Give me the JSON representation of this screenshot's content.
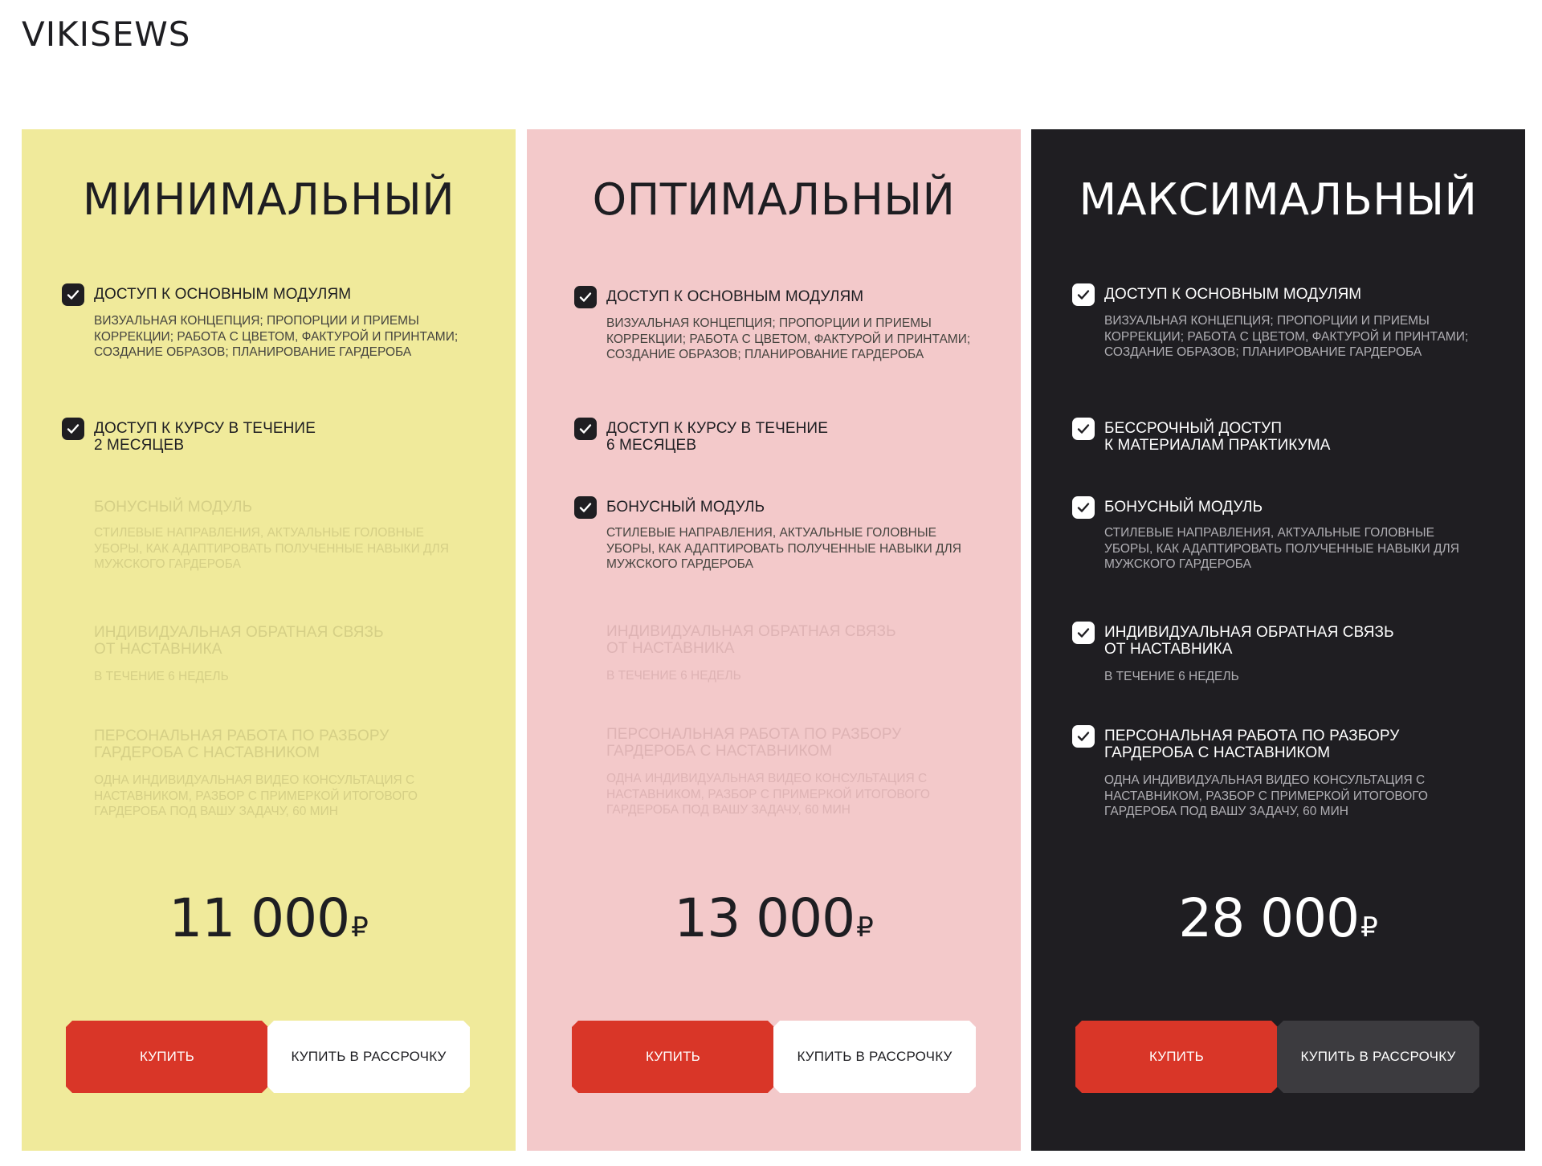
{
  "logo": "VIKISEWS",
  "plans": [
    {
      "title": "МИНИМАЛЬНЫЙ",
      "features": [
        {
          "included": true,
          "head": "ДОСТУП К ОСНОВНЫМ МОДУЛЯМ",
          "desc": "ВИЗУАЛЬНАЯ КОНЦЕПЦИЯ; ПРОПОРЦИИ И ПРИЕМЫ КОРРЕКЦИИ; РАБОТА С ЦВЕТОМ, ФАКТУРОЙ И ПРИНТАМИ; СОЗДАНИЕ ОБРАЗОВ; ПЛАНИРОВАНИЕ ГАРДЕРОБА"
        },
        {
          "included": true,
          "head": "ДОСТУП К КУРСУ В ТЕЧЕНИЕ\n2 МЕСЯЦЕВ",
          "desc": ""
        },
        {
          "included": false,
          "head": "БОНУСНЫЙ МОДУЛЬ",
          "desc": "СТИЛЕВЫЕ НАПРАВЛЕНИЯ, АКТУАЛЬНЫЕ ГОЛОВНЫЕ УБОРЫ, КАК АДАПТИРОВАТЬ ПОЛУЧЕННЫЕ НАВЫКИ ДЛЯ МУЖСКОГО ГАРДЕРОБА"
        },
        {
          "included": false,
          "head": "ИНДИВИДУАЛЬНАЯ ОБРАТНАЯ СВЯЗЬ\nОТ НАСТАВНИКА",
          "desc": "В ТЕЧЕНИЕ 6 НЕДЕЛЬ"
        },
        {
          "included": false,
          "head": "ПЕРСОНАЛЬНАЯ РАБОТА ПО РАЗБОРУ\nГАРДЕРОБА С НАСТАВНИКОМ",
          "desc": "ОДНА ИНДИВИДУАЛЬНАЯ ВИДЕО КОНСУЛЬТАЦИЯ С НАСТАВНИКОМ, РАЗБОР С ПРИМЕРКОЙ ИТОГОВОГО ГАРДЕРОБА ПОД ВАШУ ЗАДАЧУ, 60 МИН"
        }
      ],
      "price": "11 000",
      "currency": "₽",
      "buy_label": "КУПИТЬ",
      "installment_label": "КУПИТЬ В РАССРОЧКУ"
    },
    {
      "title": "ОПТИМАЛЬНЫЙ",
      "features": [
        {
          "included": true,
          "head": "ДОСТУП К ОСНОВНЫМ МОДУЛЯМ",
          "desc": "ВИЗУАЛЬНАЯ КОНЦЕПЦИЯ; ПРОПОРЦИИ И ПРИЕМЫ КОРРЕКЦИИ; РАБОТА С ЦВЕТОМ, ФАКТУРОЙ И ПРИНТАМИ; СОЗДАНИЕ ОБРАЗОВ; ПЛАНИРОВАНИЕ ГАРДЕРОБА"
        },
        {
          "included": true,
          "head": "ДОСТУП К КУРСУ В ТЕЧЕНИЕ\n6 МЕСЯЦЕВ",
          "desc": ""
        },
        {
          "included": true,
          "head": "БОНУСНЫЙ МОДУЛЬ",
          "desc": "СТИЛЕВЫЕ НАПРАВЛЕНИЯ, АКТУАЛЬНЫЕ ГОЛОВНЫЕ УБОРЫ, КАК АДАПТИРОВАТЬ ПОЛУЧЕННЫЕ НАВЫКИ ДЛЯ МУЖСКОГО ГАРДЕРОБА"
        },
        {
          "included": false,
          "head": "ИНДИВИДУАЛЬНАЯ ОБРАТНАЯ СВЯЗЬ\nОТ НАСТАВНИКА",
          "desc": "В ТЕЧЕНИЕ 6 НЕДЕЛЬ"
        },
        {
          "included": false,
          "head": "ПЕРСОНАЛЬНАЯ РАБОТА ПО РАЗБОРУ\nГАРДЕРОБА С НАСТАВНИКОМ",
          "desc": "ОДНА ИНДИВИДУАЛЬНАЯ ВИДЕО КОНСУЛЬТАЦИЯ С НАСТАВНИКОМ, РАЗБОР С ПРИМЕРКОЙ ИТОГОВОГО ГАРДЕРОБА ПОД ВАШУ ЗАДАЧУ, 60 МИН"
        }
      ],
      "price": "13 000",
      "currency": "₽",
      "buy_label": "КУПИТЬ",
      "installment_label": "КУПИТЬ В РАССРОЧКУ"
    },
    {
      "title": "МАКСИМАЛЬНЫЙ",
      "features": [
        {
          "included": true,
          "head": "ДОСТУП К ОСНОВНЫМ МОДУЛЯМ",
          "desc": "ВИЗУАЛЬНАЯ КОНЦЕПЦИЯ; ПРОПОРЦИИ И ПРИЕМЫ КОРРЕКЦИИ; РАБОТА С ЦВЕТОМ, ФАКТУРОЙ И ПРИНТАМИ; СОЗДАНИЕ ОБРАЗОВ; ПЛАНИРОВАНИЕ ГАРДЕРОБА"
        },
        {
          "included": true,
          "head": "БЕССРОЧНЫЙ ДОСТУП\nК МАТЕРИАЛАМ ПРАКТИКУМА",
          "desc": ""
        },
        {
          "included": true,
          "head": "БОНУСНЫЙ МОДУЛЬ",
          "desc": "СТИЛЕВЫЕ НАПРАВЛЕНИЯ, АКТУАЛЬНЫЕ ГОЛОВНЫЕ УБОРЫ, КАК АДАПТИРОВАТЬ ПОЛУЧЕННЫЕ НАВЫКИ ДЛЯ МУЖСКОГО ГАРДЕРОБА"
        },
        {
          "included": true,
          "head": "ИНДИВИДУАЛЬНАЯ ОБРАТНАЯ СВЯЗЬ\nОТ НАСТАВНИКА",
          "desc": "В ТЕЧЕНИЕ 6 НЕДЕЛЬ"
        },
        {
          "included": true,
          "head": "ПЕРСОНАЛЬНАЯ РАБОТА ПО РАЗБОРУ\nГАРДЕРОБА С НАСТАВНИКОМ",
          "desc": "ОДНА ИНДИВИДУАЛЬНАЯ ВИДЕО КОНСУЛЬТАЦИЯ С НАСТАВНИКОМ, РАЗБОР С ПРИМЕРКОЙ ИТОГОВОГО ГАРДЕРОБА ПОД ВАШУ ЗАДАЧУ, 60 МИН"
        }
      ],
      "price": "28 000",
      "currency": "₽",
      "buy_label": "КУПИТЬ",
      "installment_label": "КУПИТЬ В РАССРОЧКУ"
    }
  ],
  "colors": {
    "minimal_bg": "#f0ea9b",
    "optimal_bg": "#f3c9ca",
    "maximal_bg": "#1f1e22",
    "buy_button": "#d93628",
    "text_dark": "#1e1e22"
  },
  "icons": {
    "feature_check": "checkmark-icon"
  }
}
